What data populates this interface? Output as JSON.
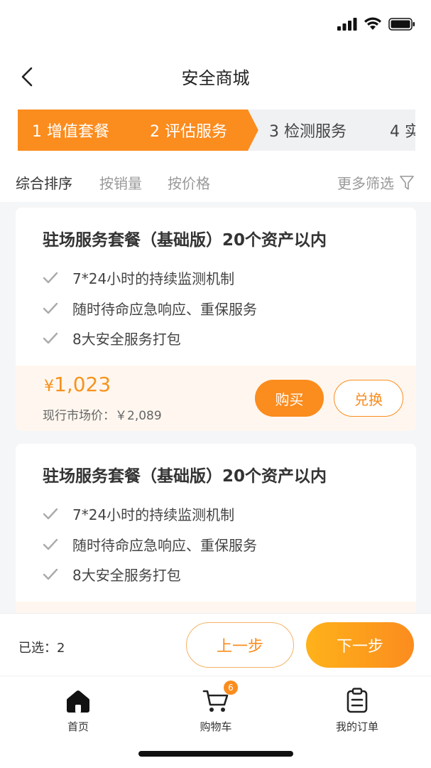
{
  "nav": {
    "title": "安全商城"
  },
  "steps": [
    {
      "label": "1 增值套餐"
    },
    {
      "label": "2 评估服务"
    },
    {
      "label": "3 检测服务"
    },
    {
      "label": "4 实"
    }
  ],
  "filters": {
    "sort_overall": "综合排序",
    "sort_sales": "按销量",
    "sort_price": "按价格",
    "more": "更多筛选"
  },
  "products": [
    {
      "title": "驻场服务套餐（基础版）20个资产以内",
      "features": [
        "7*24小时的持续监测机制",
        "随时待命应急响应、重保服务",
        "8大安全服务打包"
      ],
      "price_symbol": "¥",
      "price": "1,023",
      "market_price": "现行市场价：￥2,089",
      "buy_label": "购买",
      "exchange_label": "兑换"
    },
    {
      "title": "驻场服务套餐（基础版）20个资产以内",
      "features": [
        "7*24小时的持续监测机制",
        "随时待命应急响应、重保服务",
        "8大安全服务打包"
      ]
    }
  ],
  "action_bar": {
    "selected": "已选：2",
    "prev_label": "上一步",
    "next_label": "下一步"
  },
  "tabs": {
    "home": "首页",
    "cart": "购物车",
    "cart_badge": "6",
    "orders": "我的订单"
  },
  "colors": {
    "accent": "#fb8c1e",
    "accent_light": "#ffb21a",
    "price_bg": "#fff7ef"
  }
}
